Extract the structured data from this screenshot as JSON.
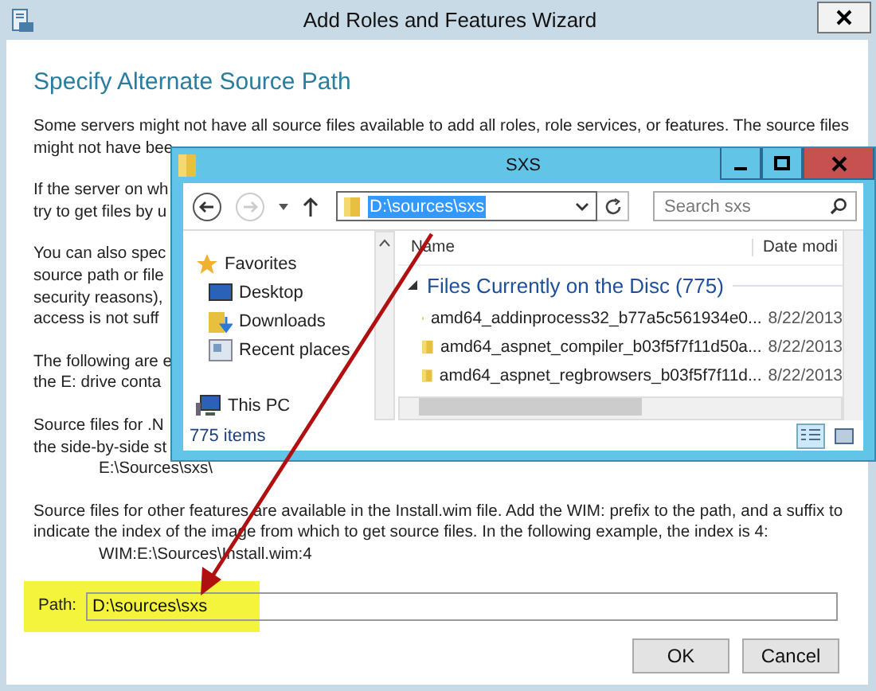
{
  "wizard": {
    "title": "Add Roles and Features Wizard",
    "heading": "Specify Alternate Source Path",
    "blocks": [
      {
        "lines": [
          {
            "text": "Some servers might not have all source files available to add all roles, role services, or features. The source files",
            "kind": "text"
          },
          {
            "text": "might not have bee",
            "kind": "text"
          }
        ]
      },
      {
        "lines": [
          {
            "text": "If the server on wh",
            "kind": "text"
          },
          {
            "text": "try to get files by u",
            "kind": "text"
          }
        ]
      },
      {
        "lines": [
          {
            "text": "You can also spec",
            "kind": "text"
          },
          {
            "text": "source path or file",
            "kind": "text"
          },
          {
            "text": "security reasons),",
            "kind": "text"
          },
          {
            "text": "access is not suff",
            "kind": "text"
          }
        ]
      },
      {
        "lines": [
          {
            "text": "The following are e",
            "kind": "text"
          },
          {
            "text": "the E: drive conta",
            "kind": "text"
          }
        ]
      },
      {
        "lines": [
          {
            "text": "Source files for .N",
            "kind": "text"
          },
          {
            "text": "the side-by-side st",
            "kind": "text"
          },
          {
            "text": "E:\\Sources\\sxs\\",
            "kind": "example"
          }
        ]
      },
      {
        "lines": [
          {
            "text": "Source files for other features are available in the Install.wim file. Add the WIM: prefix to the path, and a suffix to",
            "kind": "text"
          },
          {
            "text": "indicate the index of the image from which to get source files. In the following example, the index is 4:",
            "kind": "text"
          },
          {
            "text": "WIM:E:\\Sources\\Install.wim:4",
            "kind": "example"
          }
        ]
      }
    ],
    "path_field": {
      "label": "Path:",
      "value": "D:\\sources\\sxs",
      "highlighted": true
    },
    "buttons": [
      "OK",
      "Cancel"
    ]
  },
  "explorer": {
    "title": "SXS",
    "address": "D:\\sources\\sxs",
    "address_selected": true,
    "search": {
      "placeholder": "Search sxs"
    },
    "nav": [
      {
        "label": "Favorites",
        "kind": "favorites"
      },
      {
        "label": "Desktop",
        "kind": "desktop"
      },
      {
        "label": "Downloads",
        "kind": "downloads"
      },
      {
        "label": "Recent places",
        "kind": "recent"
      },
      {
        "label": "This PC",
        "kind": "pc"
      }
    ],
    "columns": [
      "Name",
      "Date modi"
    ],
    "group": "Files Currently on the Disc (775)",
    "files": [
      {
        "name": "amd64_addinprocess32_b77a5c561934e0...",
        "date": "8/22/2013"
      },
      {
        "name": "amd64_aspnet_compiler_b03f5f7f11d50a...",
        "date": "8/22/2013"
      },
      {
        "name": "amd64_aspnet_regbrowsers_b03f5f7f11d...",
        "date": "8/22/2013"
      }
    ],
    "status": "775 items",
    "views": [
      {
        "kind": "details",
        "selected": true
      },
      {
        "kind": "tiles",
        "selected": false
      }
    ]
  }
}
